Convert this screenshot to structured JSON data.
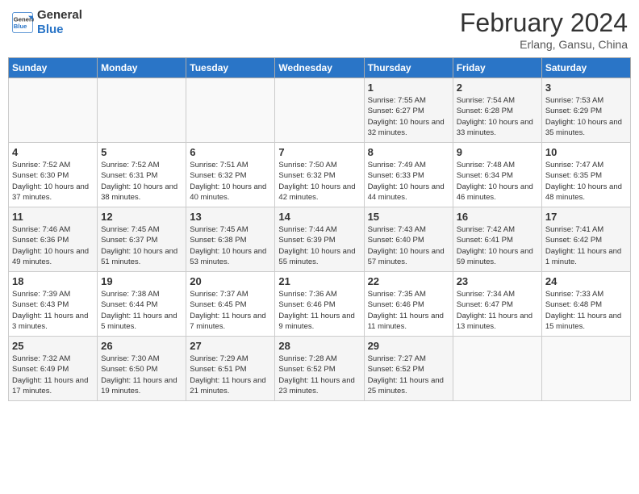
{
  "header": {
    "logo_line1": "General",
    "logo_line2": "Blue",
    "title": "February 2024",
    "subtitle": "Erlang, Gansu, China"
  },
  "weekdays": [
    "Sunday",
    "Monday",
    "Tuesday",
    "Wednesday",
    "Thursday",
    "Friday",
    "Saturday"
  ],
  "weeks": [
    [
      {
        "day": "",
        "info": ""
      },
      {
        "day": "",
        "info": ""
      },
      {
        "day": "",
        "info": ""
      },
      {
        "day": "",
        "info": ""
      },
      {
        "day": "1",
        "info": "Sunrise: 7:55 AM\nSunset: 6:27 PM\nDaylight: 10 hours and 32 minutes."
      },
      {
        "day": "2",
        "info": "Sunrise: 7:54 AM\nSunset: 6:28 PM\nDaylight: 10 hours and 33 minutes."
      },
      {
        "day": "3",
        "info": "Sunrise: 7:53 AM\nSunset: 6:29 PM\nDaylight: 10 hours and 35 minutes."
      }
    ],
    [
      {
        "day": "4",
        "info": "Sunrise: 7:52 AM\nSunset: 6:30 PM\nDaylight: 10 hours and 37 minutes."
      },
      {
        "day": "5",
        "info": "Sunrise: 7:52 AM\nSunset: 6:31 PM\nDaylight: 10 hours and 38 minutes."
      },
      {
        "day": "6",
        "info": "Sunrise: 7:51 AM\nSunset: 6:32 PM\nDaylight: 10 hours and 40 minutes."
      },
      {
        "day": "7",
        "info": "Sunrise: 7:50 AM\nSunset: 6:32 PM\nDaylight: 10 hours and 42 minutes."
      },
      {
        "day": "8",
        "info": "Sunrise: 7:49 AM\nSunset: 6:33 PM\nDaylight: 10 hours and 44 minutes."
      },
      {
        "day": "9",
        "info": "Sunrise: 7:48 AM\nSunset: 6:34 PM\nDaylight: 10 hours and 46 minutes."
      },
      {
        "day": "10",
        "info": "Sunrise: 7:47 AM\nSunset: 6:35 PM\nDaylight: 10 hours and 48 minutes."
      }
    ],
    [
      {
        "day": "11",
        "info": "Sunrise: 7:46 AM\nSunset: 6:36 PM\nDaylight: 10 hours and 49 minutes."
      },
      {
        "day": "12",
        "info": "Sunrise: 7:45 AM\nSunset: 6:37 PM\nDaylight: 10 hours and 51 minutes."
      },
      {
        "day": "13",
        "info": "Sunrise: 7:45 AM\nSunset: 6:38 PM\nDaylight: 10 hours and 53 minutes."
      },
      {
        "day": "14",
        "info": "Sunrise: 7:44 AM\nSunset: 6:39 PM\nDaylight: 10 hours and 55 minutes."
      },
      {
        "day": "15",
        "info": "Sunrise: 7:43 AM\nSunset: 6:40 PM\nDaylight: 10 hours and 57 minutes."
      },
      {
        "day": "16",
        "info": "Sunrise: 7:42 AM\nSunset: 6:41 PM\nDaylight: 10 hours and 59 minutes."
      },
      {
        "day": "17",
        "info": "Sunrise: 7:41 AM\nSunset: 6:42 PM\nDaylight: 11 hours and 1 minute."
      }
    ],
    [
      {
        "day": "18",
        "info": "Sunrise: 7:39 AM\nSunset: 6:43 PM\nDaylight: 11 hours and 3 minutes."
      },
      {
        "day": "19",
        "info": "Sunrise: 7:38 AM\nSunset: 6:44 PM\nDaylight: 11 hours and 5 minutes."
      },
      {
        "day": "20",
        "info": "Sunrise: 7:37 AM\nSunset: 6:45 PM\nDaylight: 11 hours and 7 minutes."
      },
      {
        "day": "21",
        "info": "Sunrise: 7:36 AM\nSunset: 6:46 PM\nDaylight: 11 hours and 9 minutes."
      },
      {
        "day": "22",
        "info": "Sunrise: 7:35 AM\nSunset: 6:46 PM\nDaylight: 11 hours and 11 minutes."
      },
      {
        "day": "23",
        "info": "Sunrise: 7:34 AM\nSunset: 6:47 PM\nDaylight: 11 hours and 13 minutes."
      },
      {
        "day": "24",
        "info": "Sunrise: 7:33 AM\nSunset: 6:48 PM\nDaylight: 11 hours and 15 minutes."
      }
    ],
    [
      {
        "day": "25",
        "info": "Sunrise: 7:32 AM\nSunset: 6:49 PM\nDaylight: 11 hours and 17 minutes."
      },
      {
        "day": "26",
        "info": "Sunrise: 7:30 AM\nSunset: 6:50 PM\nDaylight: 11 hours and 19 minutes."
      },
      {
        "day": "27",
        "info": "Sunrise: 7:29 AM\nSunset: 6:51 PM\nDaylight: 11 hours and 21 minutes."
      },
      {
        "day": "28",
        "info": "Sunrise: 7:28 AM\nSunset: 6:52 PM\nDaylight: 11 hours and 23 minutes."
      },
      {
        "day": "29",
        "info": "Sunrise: 7:27 AM\nSunset: 6:52 PM\nDaylight: 11 hours and 25 minutes."
      },
      {
        "day": "",
        "info": ""
      },
      {
        "day": "",
        "info": ""
      }
    ]
  ]
}
